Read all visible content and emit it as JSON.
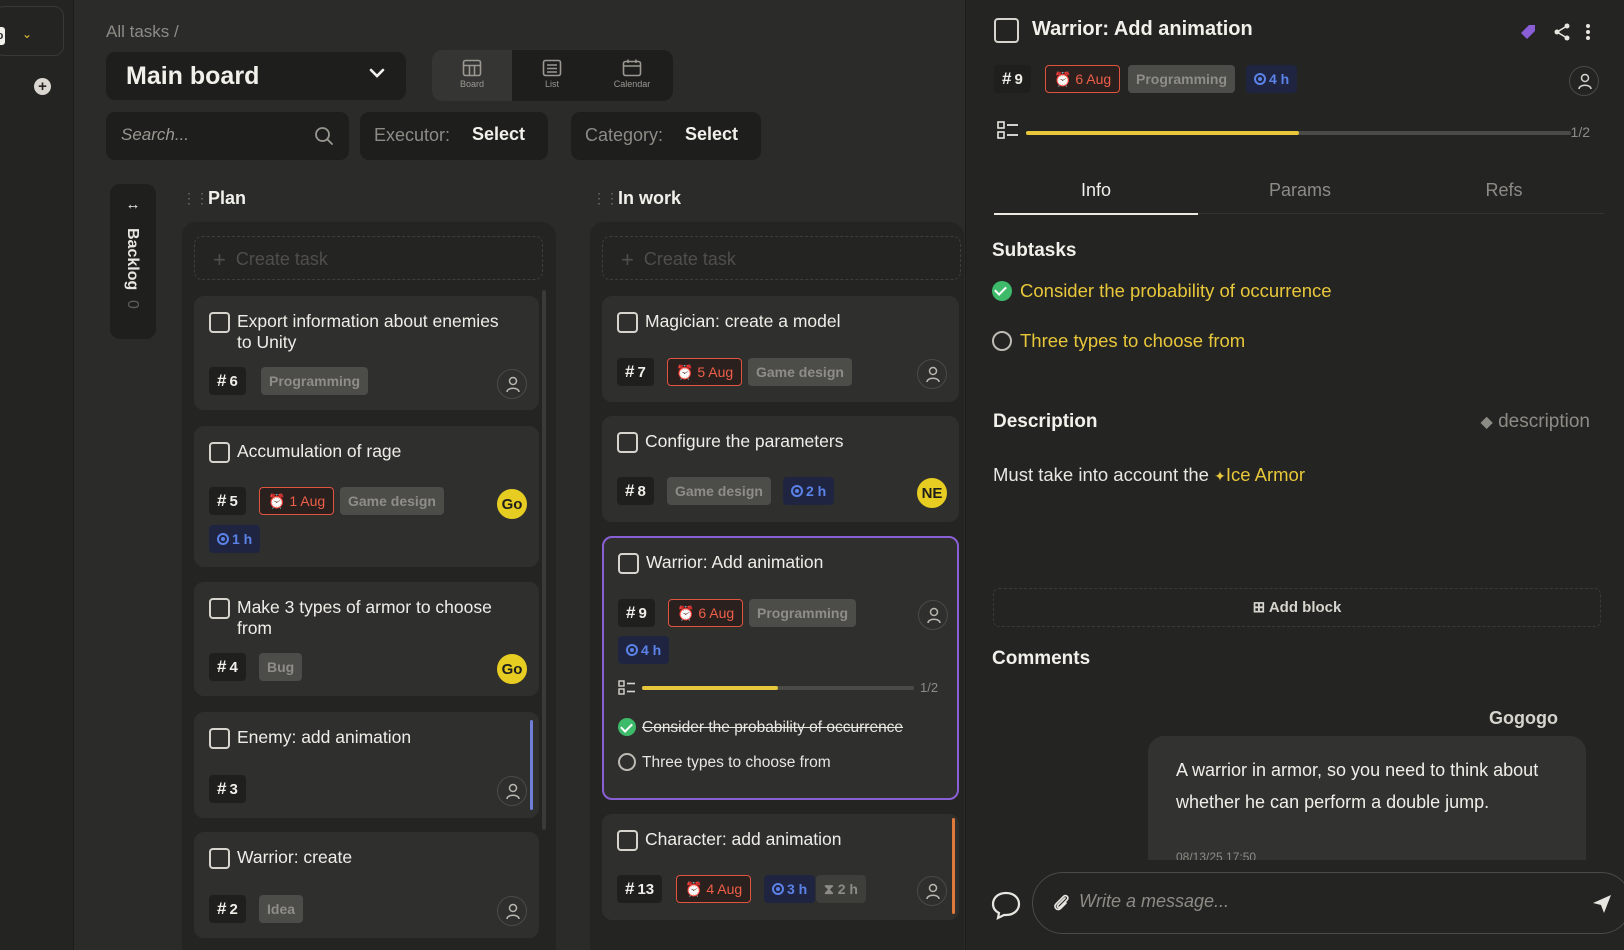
{
  "breadcrumb": "All tasks /",
  "board_name": "Main board",
  "views": [
    {
      "label": "Board"
    },
    {
      "label": "List"
    },
    {
      "label": "Calendar"
    }
  ],
  "search_placeholder": "Search...",
  "filters": {
    "executor_label": "Executor:",
    "executor_value": "Select",
    "category_label": "Category:",
    "category_value": "Select"
  },
  "backlog": {
    "label": "Backlog",
    "count": "0"
  },
  "create_task_label": "Create task",
  "columns": [
    {
      "title": "Plan",
      "cards": [
        {
          "title": "Export information about enemies to Unity",
          "num": "6",
          "category": "Programming"
        },
        {
          "title": "Accumulation of rage",
          "num": "5",
          "date": "1 Aug",
          "category": "Game design",
          "time": "1 h",
          "assignee": "Go"
        },
        {
          "title": "Make 3 types of armor to choose from",
          "num": "4",
          "category": "Bug",
          "assignee": "Go"
        },
        {
          "title": "Enemy: add animation",
          "num": "3"
        },
        {
          "title": "Warrior: create",
          "num": "2",
          "category": "Idea"
        }
      ]
    },
    {
      "title": "In work",
      "cards": [
        {
          "title": "Magician: create a model",
          "num": "7",
          "date": "5 Aug",
          "category": "Game design"
        },
        {
          "title": "Configure the parameters",
          "num": "8",
          "category": "Game design",
          "time": "2 h",
          "assignee": "NE"
        },
        {
          "title": "Warrior: Add animation",
          "num": "9",
          "date": "6 Aug",
          "category": "Programming",
          "time": "4 h",
          "progress": "1/2",
          "subtasks": [
            "Consider the probability of occurrence",
            "Three types to choose from"
          ]
        },
        {
          "title": "Character: add animation",
          "num": "13",
          "date": "4 Aug",
          "time": "3 h",
          "estimate": "2 h"
        }
      ]
    }
  ],
  "detail": {
    "title": "Warrior: Add animation",
    "num": "9",
    "date": "6 Aug",
    "category": "Programming",
    "time": "4 h",
    "progress": "1/2",
    "tabs": [
      "Info",
      "Params",
      "Refs"
    ],
    "subtasks_heading": "Subtasks",
    "subtasks": [
      "Consider the probability of occurrence",
      "Three types to choose from"
    ],
    "description_heading": "Description",
    "description_hint": "description",
    "description_text": "Must take into account the",
    "description_link": "Ice Armor",
    "add_block_label": "Add block",
    "comments_heading": "Comments",
    "comment": {
      "author": "Gogogo",
      "text": "A warrior in armor, so you need to think about whether he can perform a double jump.",
      "time": "08/13/25 17:50"
    },
    "message_placeholder": "Write a message..."
  },
  "colors": {
    "accent": "#e8c73a",
    "danger": "#ef5e48",
    "time": "#5b82e8",
    "selected": "#8a5fd6"
  }
}
